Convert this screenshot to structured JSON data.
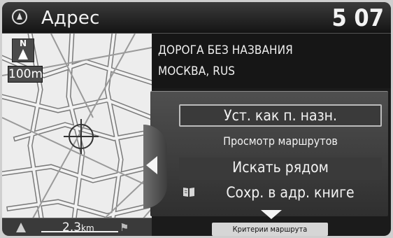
{
  "header": {
    "title": "Адрес",
    "clock": "5 07"
  },
  "map": {
    "north_label": "N",
    "zoom_label": "100m",
    "footer_scale": "2.3",
    "footer_unit": "km"
  },
  "address": {
    "line1": "ДОРОГА БЕЗ НАЗВАНИЯ",
    "line2": "МОСКВА, RUS"
  },
  "menu": {
    "items": [
      {
        "label": "Уст. как п. назн.",
        "icon": null,
        "selected": true
      },
      {
        "label": "Просмотр маршрутов",
        "icon": null,
        "selected": false
      },
      {
        "label": "Искать рядом",
        "icon": null,
        "selected": false
      },
      {
        "label": "Сохр. в адр. книге",
        "icon": "address-book-icon",
        "selected": false
      }
    ]
  },
  "footer": {
    "route_criteria_label": "Критерии маршрута"
  },
  "colors": {
    "screen_bg": "#1b1b1b",
    "text": "#f3f3f3",
    "map_bg": "#ededed"
  }
}
